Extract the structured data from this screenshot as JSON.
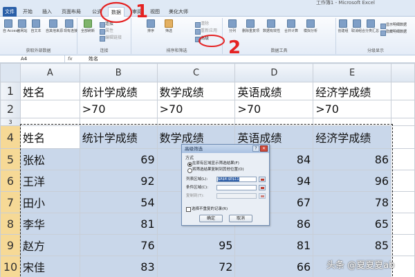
{
  "window": {
    "title": "工作簿1 - Microsoft Excel"
  },
  "tabs": [
    {
      "label": "文件",
      "active": false
    },
    {
      "label": "开始",
      "active": false
    },
    {
      "label": "插入",
      "active": false
    },
    {
      "label": "页面布局",
      "active": false
    },
    {
      "label": "公式",
      "active": false
    },
    {
      "label": "数据",
      "active": true
    },
    {
      "label": "审阅",
      "active": false
    },
    {
      "label": "视图",
      "active": false
    },
    {
      "label": "美化大师",
      "active": false
    }
  ],
  "ribbon": {
    "groups": {
      "external": "获取外部数据",
      "connections": "连接",
      "sortfilter": "排序和筛选",
      "tools": "数据工具",
      "outline": "分级显示"
    },
    "buttons": {
      "access": "自 Access",
      "web": "自网站",
      "text": "自文本",
      "other": "自其他来源",
      "existing": "现有连接",
      "refresh": "全部刷新",
      "conn": "连接",
      "props": "属性",
      "edit_links": "编辑链接",
      "sort": "排序",
      "filter": "筛选",
      "clear": "清除",
      "reapply": "重新应用",
      "advanced": "高级",
      "split": "分列",
      "dedupe": "删除重复项",
      "validate": "数据有效性",
      "consolidate": "合并计算",
      "whatif": "模拟分析",
      "group": "创建组",
      "ungroup": "取消组合",
      "subtotal": "分类汇总",
      "show_detail": "显示明细数据",
      "hide_detail": "隐藏明细数据"
    }
  },
  "annotations": {
    "one": "1",
    "two": "2"
  },
  "formula_bar": {
    "name_box": "A4",
    "fx": "fx",
    "content": "姓名"
  },
  "sheet": {
    "columns": [
      "A",
      "B",
      "C",
      "D",
      "E"
    ],
    "criteria_header": [
      "姓名",
      "统计学成绩",
      "数学成绩",
      "英语成绩",
      "经济学成绩"
    ],
    "criteria_values": [
      "",
      ">70",
      ">70",
      ">70",
      ">70"
    ],
    "empty_row_num": "3",
    "data_header": [
      "姓名",
      "统计学成绩",
      "数学成绩",
      "英语成绩",
      "经济学成绩"
    ],
    "rows": [
      {
        "num": "1"
      },
      {
        "num": "2"
      },
      {
        "num": "4"
      },
      {
        "num": "5",
        "name": "张松",
        "b": "69",
        "c": "",
        "d": "84",
        "e": "86"
      },
      {
        "num": "6",
        "name": "王洋",
        "b": "92",
        "c": "",
        "d": "94",
        "e": "96"
      },
      {
        "num": "7",
        "name": "田小",
        "b": "54",
        "c": "",
        "d": "67",
        "e": "78"
      },
      {
        "num": "8",
        "name": "李华",
        "b": "81",
        "c": "",
        "d": "86",
        "e": "65"
      },
      {
        "num": "9",
        "name": "赵方",
        "b": "76",
        "c": "95",
        "d": "81",
        "e": "85"
      },
      {
        "num": "10",
        "name": "宋佳",
        "b": "83",
        "c": "72",
        "d": "66",
        "e": ""
      }
    ]
  },
  "dialog": {
    "title": "高级筛选",
    "help": "?",
    "close": "✕",
    "method_label": "方式",
    "opt_inplace": "在原有区域显示筛选结果(F)",
    "opt_copy": "将筛选结果复制到其他位置(O)",
    "list_range_label": "列表区域(L):",
    "list_range_value": "$A$4:$E$11",
    "criteria_range_label": "条件区域(C):",
    "criteria_range_value": "",
    "copy_to_label": "复制到(T):",
    "copy_to_value": "",
    "unique_label": "选择不重复的记录(R)",
    "ok": "确定",
    "cancel": "取消"
  },
  "watermark": "头条 @夏夏夏ab"
}
